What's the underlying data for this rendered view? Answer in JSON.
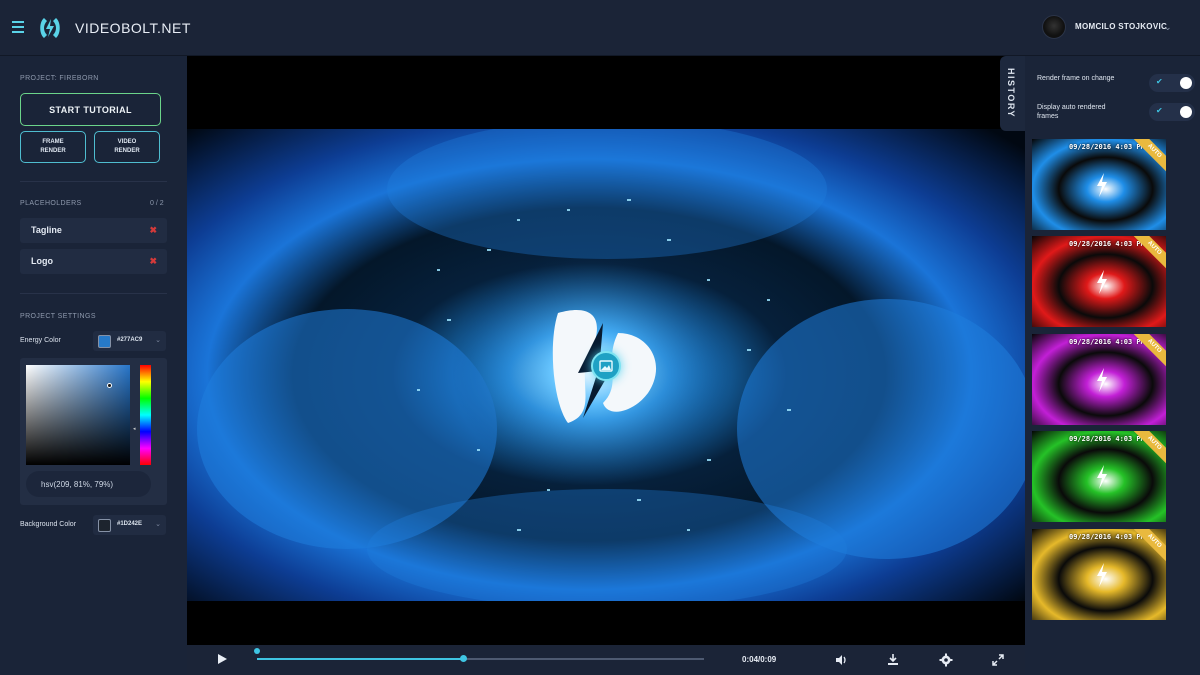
{
  "header": {
    "brand": "VIDEOBOLT.NET",
    "user_name": "MOMCILO STOJKOVIC",
    "accent_color": "#5AD3E8"
  },
  "sidebar": {
    "project_label": "PROJECT: FIREBORN",
    "start_tutorial": "START TUTORIAL",
    "frame_render": [
      "FRAME",
      "RENDER"
    ],
    "video_render": [
      "VIDEO",
      "RENDER"
    ],
    "placeholders_label": "PLACEHOLDERS",
    "placeholders_count": "0 / 2",
    "placeholders": [
      {
        "label": "Tagline",
        "remove": "✖"
      },
      {
        "label": "Logo",
        "remove": "✖"
      }
    ],
    "settings_label": "PROJECT SETTINGS",
    "energy_color_label": "Energy Color",
    "energy_color_hex": "#277AC9",
    "energy_color": "#277AC9",
    "hsv_value": "hsv(209, 81%, 79%)",
    "background_color_label": "Background Color",
    "background_color_hex": "#1D242E",
    "background_color": "#1D242E"
  },
  "player": {
    "time": "0:04/0:09",
    "progress": 0.46,
    "icons": [
      "play-icon",
      "volume-icon",
      "download-icon",
      "settings-icon",
      "fullscreen-icon"
    ]
  },
  "history": {
    "tab_label": "HISTORY",
    "toggles": [
      {
        "label": "Render frame on change",
        "on": true
      },
      {
        "label": "Display auto rendered frames",
        "on": true
      }
    ],
    "frames": [
      {
        "time": "09/28/2016 4:03 PM",
        "badge": "AUTO",
        "color": "#1f8ee8"
      },
      {
        "time": "09/28/2016 4:03 PM",
        "badge": "AUTO",
        "color": "#e01919"
      },
      {
        "time": "09/28/2016 4:03 PM",
        "badge": "AUTO",
        "color": "#c21fd6"
      },
      {
        "time": "09/28/2016 4:03 PM",
        "badge": "AUTO",
        "color": "#25c227"
      },
      {
        "time": "09/28/2016 4:03 PM",
        "badge": "AUTO",
        "color": "#e6b92a"
      }
    ]
  }
}
